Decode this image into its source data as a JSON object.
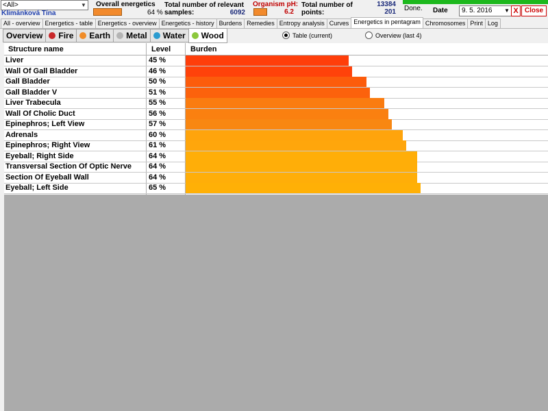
{
  "header": {
    "filter_value": "<All>",
    "patient_name": "Klimánková Tína",
    "overall_label": "Overall energetics",
    "overall_percent": "64 %",
    "samples_label_1": "Total number of relevant",
    "samples_label_2": "samples:",
    "samples_value": "6092",
    "ph_label": "Organism pH:",
    "ph_value": "6.2",
    "points_label_1": "Total number of",
    "points_label_2": "points:",
    "points_value_1": "13384",
    "points_value_2": "201",
    "status": "Done.",
    "date_label": "Date",
    "date_value": "9. 5. 2016",
    "x_label": "X",
    "close_label": "Close"
  },
  "tabs": [
    "All - overview",
    "Energetics - table",
    "Energetics - overview",
    "Energetics - history",
    "Burdens",
    "Remedies",
    "Entropy analysis",
    "Curves",
    "Energetics in pentagram",
    "Chromosomes",
    "Print",
    "Log"
  ],
  "active_tab": "Energetics in pentagram",
  "element_tabs": [
    {
      "label": "Overview",
      "color": ""
    },
    {
      "label": "Fire",
      "color": "#c8282a"
    },
    {
      "label": "Earth",
      "color": "#f08c28"
    },
    {
      "label": "Metal",
      "color": "#b4b4b4"
    },
    {
      "label": "Water",
      "color": "#2a9bd0"
    },
    {
      "label": "Wood",
      "color": "#8cc83c"
    }
  ],
  "active_element": "Wood",
  "view_options": {
    "table_label": "Table (current)",
    "overview_label": "Overview (last 4)",
    "selected": "table"
  },
  "table": {
    "columns": [
      "Structure name",
      "Level",
      "Burden"
    ],
    "rows": [
      {
        "name": "Liver",
        "level": "45 %",
        "burden": 45,
        "color": "#ff3e0a"
      },
      {
        "name": "Wall Of Gall Bladder",
        "level": "46 %",
        "burden": 46,
        "color": "#ff420a"
      },
      {
        "name": "Gall Bladder",
        "level": "50 %",
        "burden": 50,
        "color": "#fc5c0c"
      },
      {
        "name": "Gall Bladder V",
        "level": "51 %",
        "burden": 51,
        "color": "#fc620c"
      },
      {
        "name": "Liver Trabecula",
        "level": "55 %",
        "burden": 55,
        "color": "#fa7c10"
      },
      {
        "name": "Wall Of Cholic Duct",
        "level": "56 %",
        "burden": 56,
        "color": "#fa8010"
      },
      {
        "name": "Epinephros; Left View",
        "level": "57 %",
        "burden": 57,
        "color": "#f88712"
      },
      {
        "name": "Adrenals",
        "level": "60 %",
        "burden": 60,
        "color": "#ffa40c"
      },
      {
        "name": "Epinephros; Right View",
        "level": "61 %",
        "burden": 61,
        "color": "#ffa60c"
      },
      {
        "name": "Eyeball; Right Side",
        "level": "64 %",
        "burden": 64,
        "color": "#ffae08"
      },
      {
        "name": "Transversal Section Of Optic Nerve",
        "level": "64 %",
        "burden": 64,
        "color": "#ffae08"
      },
      {
        "name": "Section Of Eyeball Wall",
        "level": "64 %",
        "burden": 64,
        "color": "#ffae08"
      },
      {
        "name": "Eyeball; Left Side",
        "level": "65 %",
        "burden": 65,
        "color": "#ffb006"
      }
    ]
  }
}
